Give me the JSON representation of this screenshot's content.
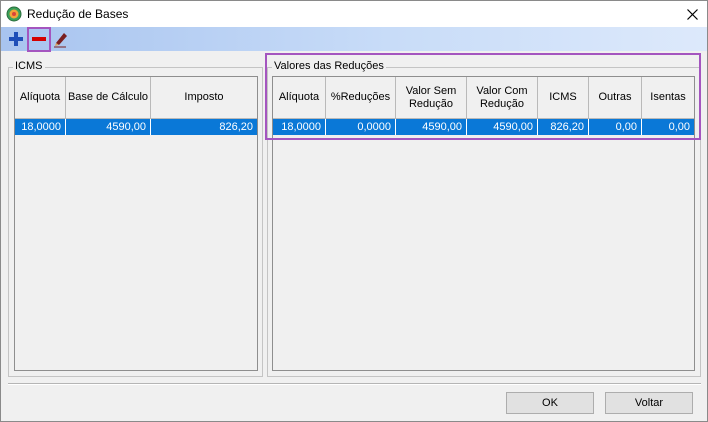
{
  "window": {
    "title": "Redução de Bases"
  },
  "toolbar": {
    "add_icon": "plus-icon",
    "remove_icon": "minus-icon",
    "edit_icon": "pencil-icon",
    "accent_add": "#1f4fb8",
    "accent_remove": "#d40000"
  },
  "icms": {
    "group_label": "ICMS",
    "columns": [
      "Alíquota",
      "Base de Cálculo",
      "Imposto"
    ],
    "rows": [
      [
        "18,0000",
        "4590,00",
        "826,20"
      ]
    ]
  },
  "reducoes": {
    "group_label": "Valores das Reduções",
    "columns": [
      "Alíquota",
      "%Reduções",
      "Valor Sem Redução",
      "Valor Com Redução",
      "ICMS",
      "Outras",
      "Isentas"
    ],
    "rows": [
      [
        "18,0000",
        "0,0000",
        "4590,00",
        "4590,00",
        "826,20",
        "0,00",
        "0,00"
      ]
    ]
  },
  "buttons": {
    "ok": "OK",
    "back": "Voltar"
  },
  "colors": {
    "selection": "#0a78d7",
    "highlight": "#a455bf"
  }
}
